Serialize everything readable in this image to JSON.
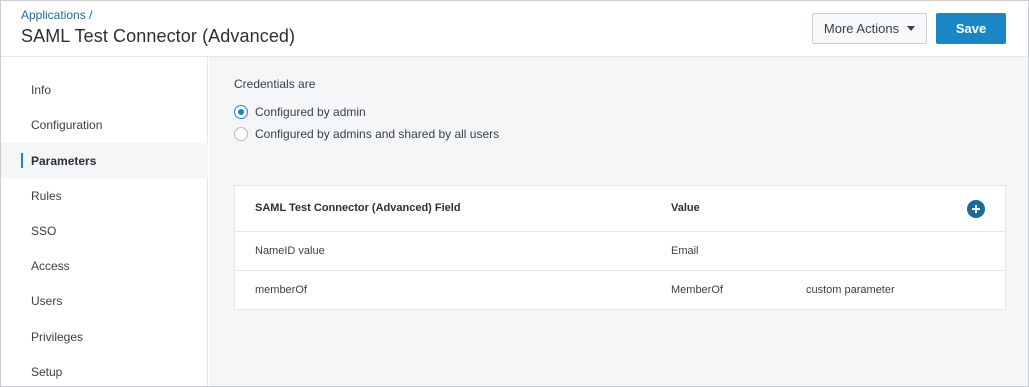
{
  "header": {
    "breadcrumb": "Applications /",
    "title": "SAML Test Connector (Advanced)",
    "more_actions_label": "More Actions",
    "save_label": "Save"
  },
  "sidebar": {
    "items": [
      {
        "label": "Info"
      },
      {
        "label": "Configuration"
      },
      {
        "label": "Parameters",
        "active": true
      },
      {
        "label": "Rules"
      },
      {
        "label": "SSO"
      },
      {
        "label": "Access"
      },
      {
        "label": "Users"
      },
      {
        "label": "Privileges"
      },
      {
        "label": "Setup"
      }
    ]
  },
  "credentials": {
    "label": "Credentials are",
    "options": [
      {
        "label": "Configured by admin",
        "selected": true
      },
      {
        "label": "Configured by admins and shared by all users",
        "selected": false
      }
    ]
  },
  "table": {
    "columns": [
      "SAML Test Connector (Advanced) Field",
      "Value"
    ],
    "rows": [
      {
        "field": "NameID value",
        "value": "Email",
        "note": ""
      },
      {
        "field": "memberOf",
        "value": "MemberOf",
        "note": "custom parameter"
      }
    ],
    "add_icon": "plus-circle-icon"
  },
  "colors": {
    "accent": "#1a86c6",
    "add_button": "#1a6a99",
    "breadcrumb": "#1f6b9a",
    "content_bg": "#f4f6f7"
  }
}
